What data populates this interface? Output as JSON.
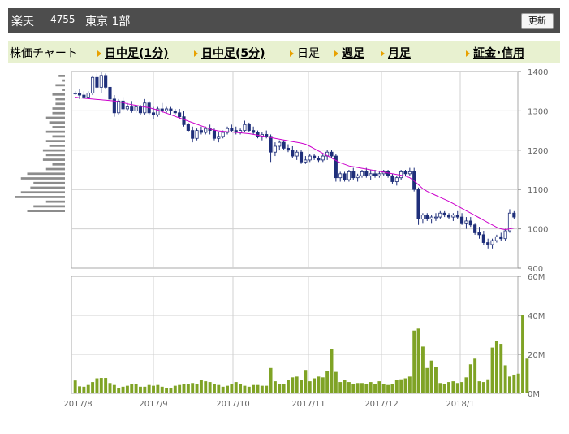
{
  "header": {
    "name": "楽天",
    "code": "4755",
    "market": "東京 1部",
    "refresh_label": "更新"
  },
  "tabs": [
    {
      "label": "株価チャート",
      "link": false,
      "arrow": false
    },
    {
      "label": "日中足(1分)",
      "link": true,
      "arrow": true
    },
    {
      "label": "日中足(5分)",
      "link": true,
      "arrow": true
    },
    {
      "label": "日足",
      "link": false,
      "arrow": true
    },
    {
      "label": "週足",
      "link": true,
      "arrow": true
    },
    {
      "label": "月足",
      "link": true,
      "arrow": true
    },
    {
      "label": "証金･信用",
      "link": true,
      "arrow": true
    }
  ],
  "chart_data": [
    {
      "type": "candlestick",
      "title": "",
      "ylim": [
        900,
        1400
      ],
      "y_ticks": [
        "1400",
        "1300",
        "1200",
        "1100",
        "1000",
        "900"
      ],
      "x_ticks": [
        "2017/8",
        "2017/9",
        "2017/10",
        "2017/11",
        "2017/12",
        "2018/1"
      ],
      "colors": {
        "up": "#ffffff",
        "down": "#1f2f7a",
        "ma": "#cc00cc",
        "volume_profile": "#8c8c8c"
      },
      "ohlc": [
        [
          1345,
          1350,
          1340,
          1345
        ],
        [
          1345,
          1355,
          1330,
          1340
        ],
        [
          1340,
          1350,
          1330,
          1335
        ],
        [
          1335,
          1350,
          1330,
          1345
        ],
        [
          1345,
          1390,
          1340,
          1385
        ],
        [
          1385,
          1395,
          1355,
          1360
        ],
        [
          1360,
          1400,
          1345,
          1390
        ],
        [
          1390,
          1395,
          1355,
          1360
        ],
        [
          1360,
          1365,
          1320,
          1330
        ],
        [
          1330,
          1340,
          1285,
          1295
        ],
        [
          1295,
          1330,
          1290,
          1325
        ],
        [
          1325,
          1335,
          1300,
          1305
        ],
        [
          1305,
          1320,
          1300,
          1310
        ],
        [
          1310,
          1325,
          1295,
          1300
        ],
        [
          1300,
          1315,
          1295,
          1310
        ],
        [
          1310,
          1315,
          1290,
          1295
        ],
        [
          1295,
          1330,
          1290,
          1320
        ],
        [
          1320,
          1325,
          1290,
          1295
        ],
        [
          1295,
          1310,
          1280,
          1290
        ],
        [
          1290,
          1310,
          1285,
          1305
        ],
        [
          1305,
          1320,
          1295,
          1300
        ],
        [
          1300,
          1310,
          1295,
          1305
        ],
        [
          1305,
          1310,
          1290,
          1300
        ],
        [
          1300,
          1305,
          1290,
          1295
        ],
        [
          1295,
          1305,
          1280,
          1285
        ],
        [
          1285,
          1300,
          1260,
          1265
        ],
        [
          1265,
          1270,
          1245,
          1250
        ],
        [
          1250,
          1260,
          1220,
          1230
        ],
        [
          1230,
          1255,
          1225,
          1250
        ],
        [
          1250,
          1260,
          1240,
          1245
        ],
        [
          1245,
          1260,
          1240,
          1255
        ],
        [
          1255,
          1265,
          1240,
          1250
        ],
        [
          1250,
          1255,
          1225,
          1230
        ],
        [
          1230,
          1245,
          1220,
          1235
        ],
        [
          1235,
          1250,
          1230,
          1245
        ],
        [
          1245,
          1260,
          1240,
          1255
        ],
        [
          1255,
          1265,
          1245,
          1250
        ],
        [
          1250,
          1260,
          1240,
          1245
        ],
        [
          1245,
          1255,
          1240,
          1250
        ],
        [
          1250,
          1275,
          1245,
          1265
        ],
        [
          1265,
          1270,
          1245,
          1250
        ],
        [
          1250,
          1260,
          1240,
          1245
        ],
        [
          1245,
          1250,
          1230,
          1235
        ],
        [
          1235,
          1245,
          1225,
          1240
        ],
        [
          1240,
          1250,
          1230,
          1235
        ],
        [
          1235,
          1240,
          1170,
          1195
        ],
        [
          1195,
          1220,
          1185,
          1210
        ],
        [
          1210,
          1225,
          1200,
          1220
        ],
        [
          1220,
          1225,
          1200,
          1205
        ],
        [
          1205,
          1215,
          1195,
          1200
        ],
        [
          1200,
          1210,
          1180,
          1185
        ],
        [
          1185,
          1200,
          1175,
          1195
        ],
        [
          1195,
          1200,
          1165,
          1170
        ],
        [
          1170,
          1185,
          1165,
          1175
        ],
        [
          1175,
          1190,
          1170,
          1185
        ],
        [
          1185,
          1190,
          1175,
          1180
        ],
        [
          1180,
          1185,
          1170,
          1175
        ],
        [
          1175,
          1190,
          1170,
          1185
        ],
        [
          1185,
          1200,
          1175,
          1195
        ],
        [
          1195,
          1200,
          1180,
          1185
        ],
        [
          1185,
          1190,
          1120,
          1130
        ],
        [
          1130,
          1145,
          1120,
          1140
        ],
        [
          1140,
          1145,
          1120,
          1125
        ],
        [
          1125,
          1150,
          1120,
          1145
        ],
        [
          1145,
          1155,
          1125,
          1130
        ],
        [
          1130,
          1140,
          1120,
          1135
        ],
        [
          1135,
          1150,
          1130,
          1145
        ],
        [
          1145,
          1155,
          1130,
          1135
        ],
        [
          1135,
          1150,
          1125,
          1140
        ],
        [
          1140,
          1150,
          1130,
          1135
        ],
        [
          1135,
          1145,
          1130,
          1140
        ],
        [
          1140,
          1150,
          1135,
          1145
        ],
        [
          1145,
          1150,
          1130,
          1135
        ],
        [
          1135,
          1140,
          1115,
          1120
        ],
        [
          1120,
          1135,
          1110,
          1130
        ],
        [
          1130,
          1150,
          1125,
          1145
        ],
        [
          1145,
          1150,
          1135,
          1140
        ],
        [
          1140,
          1155,
          1135,
          1145
        ],
        [
          1145,
          1155,
          1095,
          1100
        ],
        [
          1100,
          1105,
          1010,
          1025
        ],
        [
          1025,
          1040,
          1015,
          1035
        ],
        [
          1035,
          1040,
          1020,
          1025
        ],
        [
          1025,
          1035,
          1015,
          1030
        ],
        [
          1030,
          1040,
          1020,
          1030
        ],
        [
          1030,
          1045,
          1025,
          1040
        ],
        [
          1040,
          1045,
          1030,
          1035
        ],
        [
          1035,
          1040,
          1025,
          1030
        ],
        [
          1030,
          1040,
          1020,
          1035
        ],
        [
          1035,
          1045,
          1025,
          1030
        ],
        [
          1030,
          1040,
          1010,
          1015
        ],
        [
          1015,
          1030,
          1000,
          1020
        ],
        [
          1020,
          1030,
          1005,
          1010
        ],
        [
          1010,
          1015,
          985,
          990
        ],
        [
          990,
          1005,
          975,
          985
        ],
        [
          985,
          995,
          960,
          965
        ],
        [
          965,
          975,
          950,
          960
        ],
        [
          960,
          975,
          950,
          970
        ],
        [
          970,
          985,
          965,
          980
        ],
        [
          980,
          990,
          970,
          975
        ],
        [
          975,
          1000,
          970,
          995
        ],
        [
          995,
          1050,
          990,
          1040
        ],
        [
          1040,
          1045,
          1025,
          1030
        ]
      ],
      "ma": [
        1335,
        1333,
        1332,
        1331,
        1330,
        1329,
        1328,
        1327,
        1326,
        1325,
        1323,
        1321,
        1318,
        1316,
        1314,
        1312,
        1310,
        1308,
        1305,
        1302,
        1298,
        1294,
        1290,
        1286,
        1282,
        1278,
        1274,
        1270,
        1266,
        1262,
        1258,
        1254,
        1251,
        1249,
        1248,
        1247,
        1246,
        1245,
        1244,
        1243,
        1242,
        1240,
        1238,
        1236,
        1234,
        1232,
        1230,
        1228,
        1226,
        1224,
        1222,
        1220,
        1218,
        1215,
        1210,
        1204,
        1198,
        1192,
        1186,
        1180,
        1174,
        1168,
        1164,
        1160,
        1158,
        1156,
        1154,
        1152,
        1150,
        1148,
        1146,
        1144,
        1142,
        1140,
        1138,
        1136,
        1134,
        1130,
        1122,
        1112,
        1102,
        1095,
        1090,
        1085,
        1080,
        1075,
        1070,
        1064,
        1058,
        1052,
        1046,
        1040,
        1034,
        1028,
        1022,
        1016,
        1010,
        1004,
        1000,
        998,
        1000,
        1002
      ],
      "volume_profile": [
        2,
        1,
        3,
        1,
        4,
        3,
        3,
        4,
        4,
        6,
        5,
        4,
        6,
        4,
        6,
        5,
        7,
        6,
        7,
        4,
        6,
        12,
        14,
        10,
        11,
        14,
        16,
        6,
        10,
        12
      ]
    },
    {
      "type": "bar",
      "title": "",
      "ylim": [
        0,
        60
      ],
      "y_ticks": [
        "60M",
        "40M",
        "20M",
        "0M"
      ],
      "color": "#7fa325",
      "values": [
        6.6,
        3.6,
        3.4,
        4.3,
        5.8,
        7.7,
        7.9,
        7.9,
        5.3,
        4.3,
        2.9,
        3.4,
        3.9,
        4.8,
        4.8,
        3.4,
        3.4,
        4.3,
        3.9,
        4.3,
        3.4,
        2.9,
        2.9,
        3.9,
        4.3,
        4.8,
        4.8,
        5.3,
        4.8,
        6.7,
        6.2,
        5.8,
        4.8,
        4.3,
        3.4,
        3.9,
        4.8,
        5.8,
        4.8,
        3.9,
        3.4,
        4.3,
        4.3,
        3.9,
        3.9,
        13.0,
        6.2,
        4.8,
        4.8,
        6.7,
        8.2,
        8.6,
        6.7,
        12.0,
        6.2,
        7.7,
        8.6,
        8.2,
        11.5,
        22.6,
        11.0,
        5.8,
        6.7,
        5.8,
        4.8,
        5.3,
        5.3,
        4.8,
        5.8,
        4.8,
        6.2,
        4.8,
        4.3,
        4.8,
        6.7,
        7.2,
        7.7,
        8.6,
        32.2,
        33.2,
        24.0,
        13.0,
        16.8,
        13.4,
        5.3,
        4.8,
        5.8,
        6.2,
        5.3,
        5.8,
        8.2,
        14.9,
        17.8,
        6.2,
        5.8,
        7.2,
        23.5,
        26.9,
        25.4,
        14.4,
        8.6,
        9.6,
        10.1,
        40.3,
        17.8
      ]
    }
  ]
}
